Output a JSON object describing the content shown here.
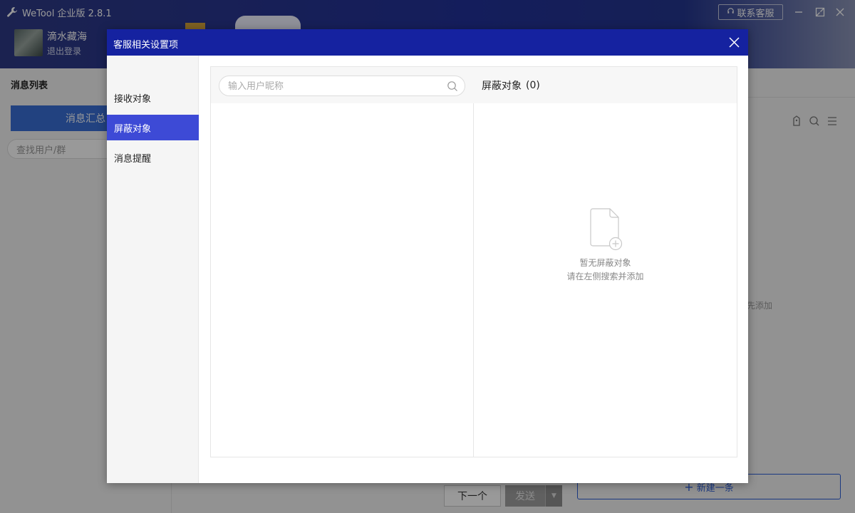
{
  "app": {
    "title": "WeTool 企业版 2.8.1",
    "contact_label": "联系客服"
  },
  "user": {
    "name": "滴水藏海",
    "logout_label": "退出登录"
  },
  "left_panel": {
    "title": "消息列表",
    "summary_button": "消息汇总",
    "search_placeholder": "查找用户/群"
  },
  "compose": {
    "next_label": "下一个",
    "send_label": "发送"
  },
  "right_panel": {
    "hint_partial": "先添加",
    "new_button_label": "新建一条"
  },
  "modal": {
    "title": "客服相关设置项",
    "nav": [
      {
        "label": "接收对象",
        "active": false
      },
      {
        "label": "屏蔽对象",
        "active": true
      },
      {
        "label": "消息提醒",
        "active": false
      }
    ],
    "search_placeholder": "输入用户昵称",
    "blocked_header": "屏蔽对象",
    "blocked_count": "(0)",
    "empty_line1": "暂无屏蔽对象",
    "empty_line2": "请在左侧搜索并添加"
  },
  "colors": {
    "modal_header": "#1522a0",
    "nav_active": "#3d4ad6",
    "topbar": "#223199",
    "primary_blue": "#2c5ed8"
  }
}
